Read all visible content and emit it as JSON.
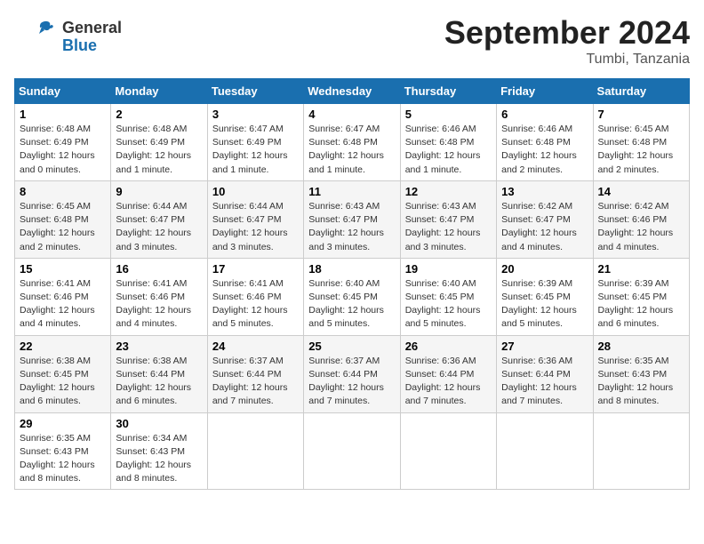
{
  "header": {
    "logo_general": "General",
    "logo_blue": "Blue",
    "month_title": "September 2024",
    "location": "Tumbi, Tanzania"
  },
  "days_of_week": [
    "Sunday",
    "Monday",
    "Tuesday",
    "Wednesday",
    "Thursday",
    "Friday",
    "Saturday"
  ],
  "weeks": [
    [
      {
        "day": "1",
        "sunrise": "6:48 AM",
        "sunset": "6:49 PM",
        "daylight": "12 hours and 0 minutes."
      },
      {
        "day": "2",
        "sunrise": "6:48 AM",
        "sunset": "6:49 PM",
        "daylight": "12 hours and 1 minute."
      },
      {
        "day": "3",
        "sunrise": "6:47 AM",
        "sunset": "6:49 PM",
        "daylight": "12 hours and 1 minute."
      },
      {
        "day": "4",
        "sunrise": "6:47 AM",
        "sunset": "6:48 PM",
        "daylight": "12 hours and 1 minute."
      },
      {
        "day": "5",
        "sunrise": "6:46 AM",
        "sunset": "6:48 PM",
        "daylight": "12 hours and 1 minute."
      },
      {
        "day": "6",
        "sunrise": "6:46 AM",
        "sunset": "6:48 PM",
        "daylight": "12 hours and 2 minutes."
      },
      {
        "day": "7",
        "sunrise": "6:45 AM",
        "sunset": "6:48 PM",
        "daylight": "12 hours and 2 minutes."
      }
    ],
    [
      {
        "day": "8",
        "sunrise": "6:45 AM",
        "sunset": "6:48 PM",
        "daylight": "12 hours and 2 minutes."
      },
      {
        "day": "9",
        "sunrise": "6:44 AM",
        "sunset": "6:47 PM",
        "daylight": "12 hours and 3 minutes."
      },
      {
        "day": "10",
        "sunrise": "6:44 AM",
        "sunset": "6:47 PM",
        "daylight": "12 hours and 3 minutes."
      },
      {
        "day": "11",
        "sunrise": "6:43 AM",
        "sunset": "6:47 PM",
        "daylight": "12 hours and 3 minutes."
      },
      {
        "day": "12",
        "sunrise": "6:43 AM",
        "sunset": "6:47 PM",
        "daylight": "12 hours and 3 minutes."
      },
      {
        "day": "13",
        "sunrise": "6:42 AM",
        "sunset": "6:47 PM",
        "daylight": "12 hours and 4 minutes."
      },
      {
        "day": "14",
        "sunrise": "6:42 AM",
        "sunset": "6:46 PM",
        "daylight": "12 hours and 4 minutes."
      }
    ],
    [
      {
        "day": "15",
        "sunrise": "6:41 AM",
        "sunset": "6:46 PM",
        "daylight": "12 hours and 4 minutes."
      },
      {
        "day": "16",
        "sunrise": "6:41 AM",
        "sunset": "6:46 PM",
        "daylight": "12 hours and 4 minutes."
      },
      {
        "day": "17",
        "sunrise": "6:41 AM",
        "sunset": "6:46 PM",
        "daylight": "12 hours and 5 minutes."
      },
      {
        "day": "18",
        "sunrise": "6:40 AM",
        "sunset": "6:45 PM",
        "daylight": "12 hours and 5 minutes."
      },
      {
        "day": "19",
        "sunrise": "6:40 AM",
        "sunset": "6:45 PM",
        "daylight": "12 hours and 5 minutes."
      },
      {
        "day": "20",
        "sunrise": "6:39 AM",
        "sunset": "6:45 PM",
        "daylight": "12 hours and 5 minutes."
      },
      {
        "day": "21",
        "sunrise": "6:39 AM",
        "sunset": "6:45 PM",
        "daylight": "12 hours and 6 minutes."
      }
    ],
    [
      {
        "day": "22",
        "sunrise": "6:38 AM",
        "sunset": "6:45 PM",
        "daylight": "12 hours and 6 minutes."
      },
      {
        "day": "23",
        "sunrise": "6:38 AM",
        "sunset": "6:44 PM",
        "daylight": "12 hours and 6 minutes."
      },
      {
        "day": "24",
        "sunrise": "6:37 AM",
        "sunset": "6:44 PM",
        "daylight": "12 hours and 7 minutes."
      },
      {
        "day": "25",
        "sunrise": "6:37 AM",
        "sunset": "6:44 PM",
        "daylight": "12 hours and 7 minutes."
      },
      {
        "day": "26",
        "sunrise": "6:36 AM",
        "sunset": "6:44 PM",
        "daylight": "12 hours and 7 minutes."
      },
      {
        "day": "27",
        "sunrise": "6:36 AM",
        "sunset": "6:44 PM",
        "daylight": "12 hours and 7 minutes."
      },
      {
        "day": "28",
        "sunrise": "6:35 AM",
        "sunset": "6:43 PM",
        "daylight": "12 hours and 8 minutes."
      }
    ],
    [
      {
        "day": "29",
        "sunrise": "6:35 AM",
        "sunset": "6:43 PM",
        "daylight": "12 hours and 8 minutes."
      },
      {
        "day": "30",
        "sunrise": "6:34 AM",
        "sunset": "6:43 PM",
        "daylight": "12 hours and 8 minutes."
      },
      null,
      null,
      null,
      null,
      null
    ]
  ]
}
